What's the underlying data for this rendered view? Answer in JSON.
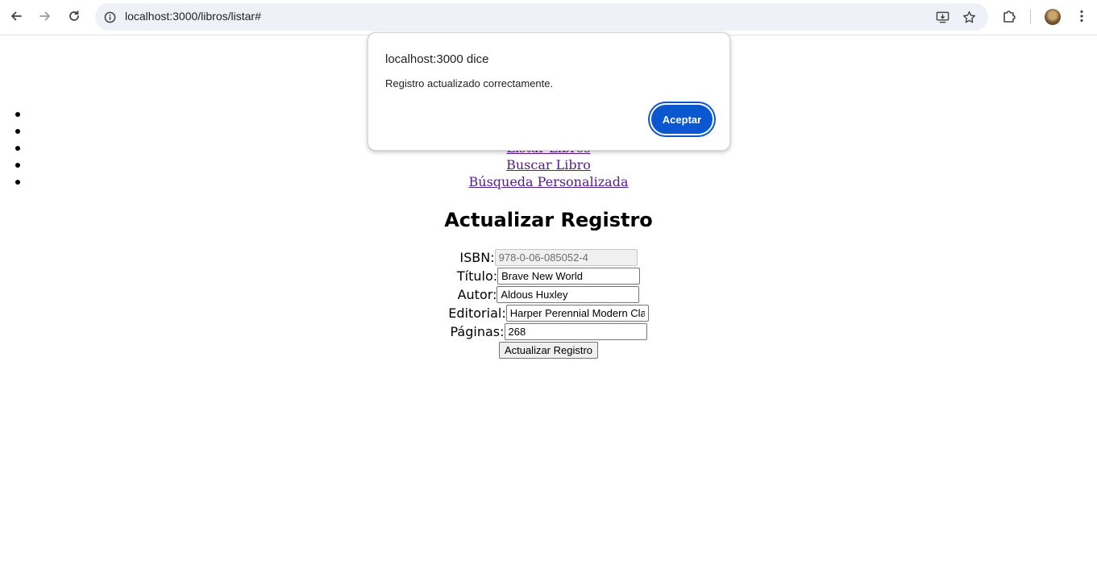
{
  "browser": {
    "url": "localhost:3000/libros/listar#"
  },
  "nav": {
    "items": [
      {
        "label": ""
      },
      {
        "label": ""
      },
      {
        "label": "Listar Libros"
      },
      {
        "label": "Buscar Libro"
      },
      {
        "label": "Búsqueda Personalizada"
      }
    ]
  },
  "form": {
    "title": "Actualizar Registro",
    "isbn_label": "ISBN:",
    "isbn_value": "978-0-06-085052-4",
    "titulo_label": "Título:",
    "titulo_value": "Brave New World",
    "autor_label": "Autor:",
    "autor_value": "Aldous Huxley",
    "editorial_label": "Editorial:",
    "editorial_value": "Harper Perennial Modern Classics",
    "paginas_label": "Páginas:",
    "paginas_value": "268",
    "submit_label": "Actualizar Registro"
  },
  "dialog": {
    "title": "localhost:3000 dice",
    "message": "Registro actualizado correctamente.",
    "ok_label": "Aceptar"
  },
  "colors": {
    "link": "#551a8b",
    "dialog_button": "#0b57d0",
    "omnibox_bg": "#eef1f8"
  }
}
